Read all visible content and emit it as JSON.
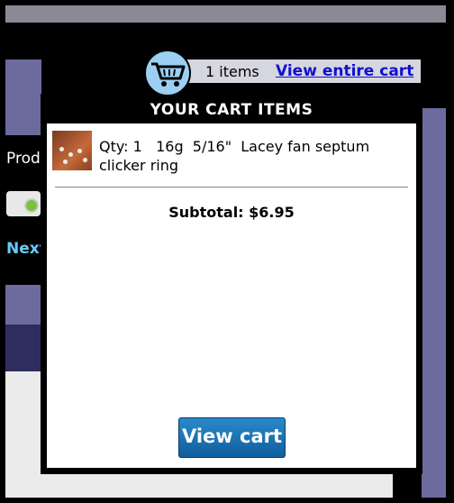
{
  "background": {
    "left_text_top": "Prod",
    "left_text_bottom": "Next"
  },
  "cart_summary": {
    "items_count": "1 items",
    "view_entire_cart": "View entire cart"
  },
  "popup": {
    "title": "YOUR CART ITEMS",
    "items": [
      {
        "text": "Qty: 1   16g  5/16\"  Lacey fan septum clicker ring"
      }
    ],
    "subtotal": "Subtotal: $6.95",
    "view_cart_button": "View cart"
  },
  "colors": {
    "panel_purple": "#6b6b9e",
    "cart_icon_bg": "#9bd0f2",
    "button_blue": "#1a74b8",
    "link_blue": "#1010cc"
  }
}
